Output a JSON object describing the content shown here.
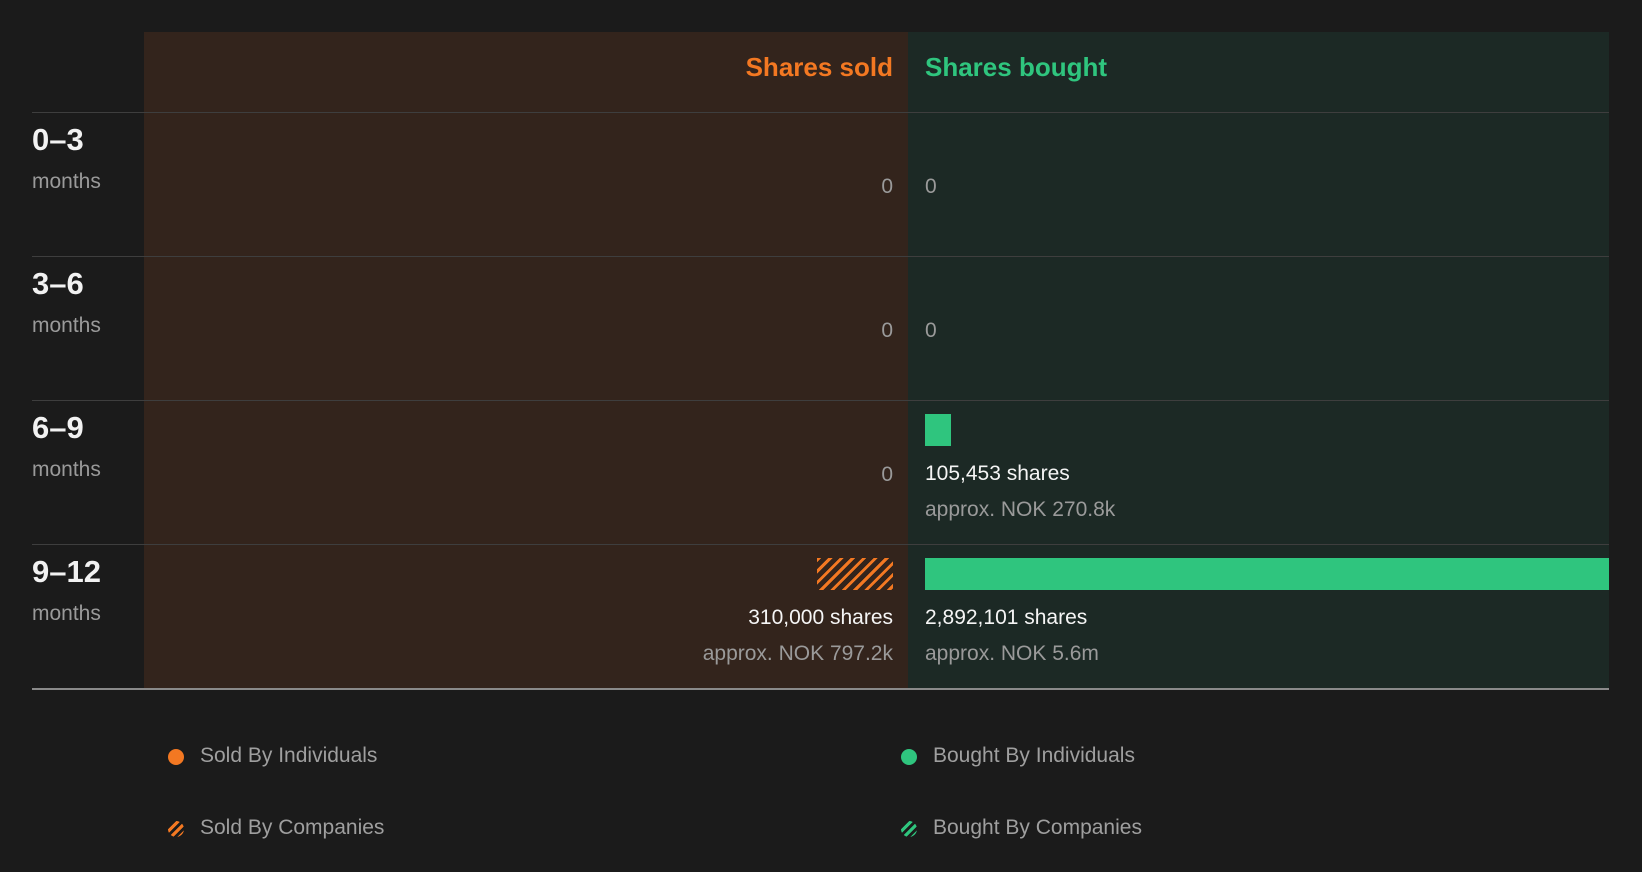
{
  "colors": {
    "sold": "#f37822",
    "bought": "#2fc57e",
    "background": "#1b1b1b",
    "sold_panel": "#33241c",
    "bought_panel": "#1c2925"
  },
  "headers": {
    "sold": "Shares sold",
    "bought": "Shares bought"
  },
  "legend": [
    {
      "label": "Sold By Individuals",
      "icon": "orange-dot-icon"
    },
    {
      "label": "Bought By Individuals",
      "icon": "green-dot-icon"
    },
    {
      "label": "Sold By Companies",
      "icon": "orange-hatched-dot-icon"
    },
    {
      "label": "Bought By Companies",
      "icon": "green-hatched-dot-icon"
    }
  ],
  "chart_data": {
    "type": "bar",
    "categories": [
      "0–3",
      "3–6",
      "6–9",
      "9–12"
    ],
    "category_unit": "months",
    "series": [
      {
        "name": "Sold By Individuals",
        "values": [
          0,
          0,
          0,
          0
        ]
      },
      {
        "name": "Sold By Companies",
        "values": [
          0,
          0,
          0,
          310000
        ]
      },
      {
        "name": "Bought By Individuals",
        "values": [
          0,
          0,
          105453,
          2892101
        ]
      },
      {
        "name": "Bought By Companies",
        "values": [
          0,
          0,
          0,
          0
        ]
      }
    ],
    "rows": [
      {
        "range": "0–3",
        "unit": "months",
        "sold": {
          "zero_label": "0"
        },
        "bought": {
          "zero_label": "0"
        }
      },
      {
        "range": "3–6",
        "unit": "months",
        "sold": {
          "zero_label": "0"
        },
        "bought": {
          "zero_label": "0"
        }
      },
      {
        "range": "6–9",
        "unit": "months",
        "sold": {
          "zero_label": "0"
        },
        "bought": {
          "shares": 105453,
          "shares_label": "105,453 shares",
          "approx_label": "approx. NOK 270.8k"
        }
      },
      {
        "range": "9–12",
        "unit": "months",
        "sold": {
          "shares": 310000,
          "shares_label": "310,000 shares",
          "approx_label": "approx. NOK 797.2k"
        },
        "bought": {
          "shares": 2892101,
          "shares_label": "2,892,101 shares",
          "approx_label": "approx. NOK 5.6m"
        }
      }
    ]
  }
}
